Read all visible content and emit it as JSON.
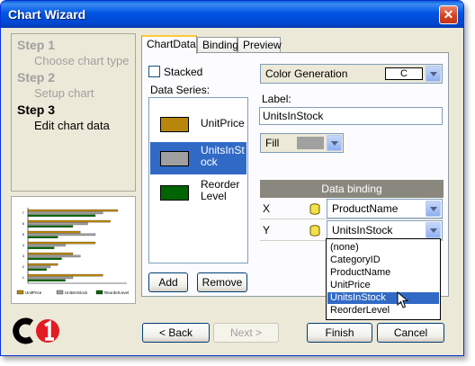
{
  "window": {
    "title": "Chart Wizard"
  },
  "steps": [
    {
      "heading": "Step 1",
      "desc": "Choose chart type",
      "current": false
    },
    {
      "heading": "Step 2",
      "desc": "Setup chart",
      "current": false
    },
    {
      "heading": "Step 3",
      "desc": "Edit chart data",
      "current": true
    }
  ],
  "tabs": [
    {
      "label": "ChartData",
      "active": true
    },
    {
      "label": "Binding",
      "active": false
    },
    {
      "label": "Preview",
      "active": false
    }
  ],
  "chartdata": {
    "stacked_label": "Stacked",
    "stacked_checked": false,
    "series_label": "Data Series:",
    "series": [
      {
        "name": "UnitPrice",
        "color": "#b8860b",
        "selected": false
      },
      {
        "name": "UnitsInStock",
        "color": "#a0a0a0",
        "selected": true
      },
      {
        "name": "ReorderLevel",
        "color": "#006400",
        "selected": false
      }
    ],
    "add_label": "Add",
    "remove_label": "Remove",
    "color_generation": {
      "label": "Color Generation",
      "value": "C"
    },
    "label_caption": "Label:",
    "label_value": "UnitsInStock",
    "fill": {
      "label": "Fill",
      "color": "#a0a0a0"
    },
    "data_binding": {
      "header": "Data binding",
      "x": {
        "axis": "X",
        "value": "ProductName"
      },
      "y": {
        "axis": "Y",
        "value": "UnitsInStock"
      }
    },
    "dropdown_options": [
      "(none)",
      "CategoryID",
      "ProductName",
      "UnitPrice",
      "UnitsInStock",
      "ReorderLevel"
    ],
    "dropdown_selected": "UnitsInStock"
  },
  "preview_chart": {
    "type": "bar",
    "categories": [
      "1",
      "2",
      "3",
      "4",
      "5",
      "6",
      "7"
    ],
    "series": [
      {
        "name": "UnitPrice",
        "color": "#b8860b",
        "values": [
          20,
          8,
          12,
          18,
          14,
          22,
          24
        ]
      },
      {
        "name": "UnitsInStock",
        "color": "#a0a0a0",
        "values": [
          12,
          6,
          14,
          10,
          18,
          16,
          20
        ]
      },
      {
        "name": "ReorderLevel",
        "color": "#006400",
        "values": [
          10,
          5,
          9,
          7,
          8,
          12,
          18
        ]
      }
    ],
    "legend": [
      "UnitPrice",
      "UnitsInStock",
      "ReorderLevel"
    ]
  },
  "buttons": {
    "back": "< Back",
    "next": "Next >",
    "finish": "Finish",
    "cancel": "Cancel"
  },
  "colors": {
    "accent": "#316ac5",
    "titlebar": "#0054e3"
  }
}
